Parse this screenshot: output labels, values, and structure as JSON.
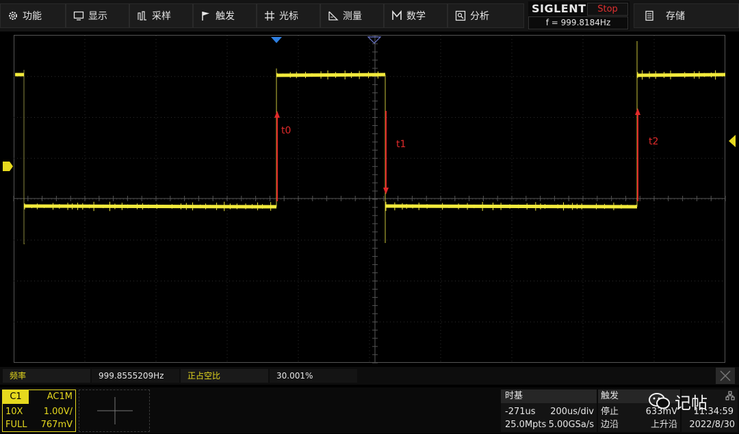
{
  "menu": {
    "items": [
      {
        "name": "function",
        "label": "功能",
        "icon": "gear-icon"
      },
      {
        "name": "display",
        "label": "显示",
        "icon": "monitor-icon"
      },
      {
        "name": "acquire",
        "label": "采样",
        "icon": "sampling-icon"
      },
      {
        "name": "trigger",
        "label": "触发",
        "icon": "flag-icon"
      },
      {
        "name": "cursor",
        "label": "光标",
        "icon": "cursor-grid-icon"
      },
      {
        "name": "measure",
        "label": "测量",
        "icon": "measure-icon"
      },
      {
        "name": "math",
        "label": "数学",
        "icon": "math-icon"
      },
      {
        "name": "analysis",
        "label": "分析",
        "icon": "analysis-icon"
      },
      {
        "name": "save",
        "label": "存储",
        "icon": "storage-icon"
      }
    ]
  },
  "brand": {
    "logo": "SIGLENT",
    "status": "Stop",
    "freq": "f = 999.8184Hz"
  },
  "annotations": {
    "t0": "t0",
    "t1": "t1",
    "t2": "t2"
  },
  "measurements": {
    "freq_label": "频率",
    "freq_value": "999.8555209Hz",
    "duty_label": "正占空比",
    "duty_value": "30.001%"
  },
  "channel": {
    "name": "C1",
    "coupling": "AC1M",
    "probe": "10X",
    "scale": "1.00V/",
    "bandwidth": "FULL",
    "offset": "767mV"
  },
  "timebase": {
    "label": "时基",
    "delay": "-271us",
    "scale": "200us/div",
    "memory": "25.0Mpts",
    "sample_rate": "5.00GSa/s"
  },
  "trigger": {
    "label": "触发",
    "mode": "停止",
    "level": "633mV",
    "type": "边沿",
    "slope": "上升沿"
  },
  "clock": {
    "time": "11:34:59",
    "date": "2022/8/30"
  },
  "watermark": {
    "text": "记帖"
  },
  "colors": {
    "trace": "#f2ea3c",
    "accent": "#2d7ee0",
    "annotation": "#e02a2a",
    "channel": "#e6d91e"
  }
}
